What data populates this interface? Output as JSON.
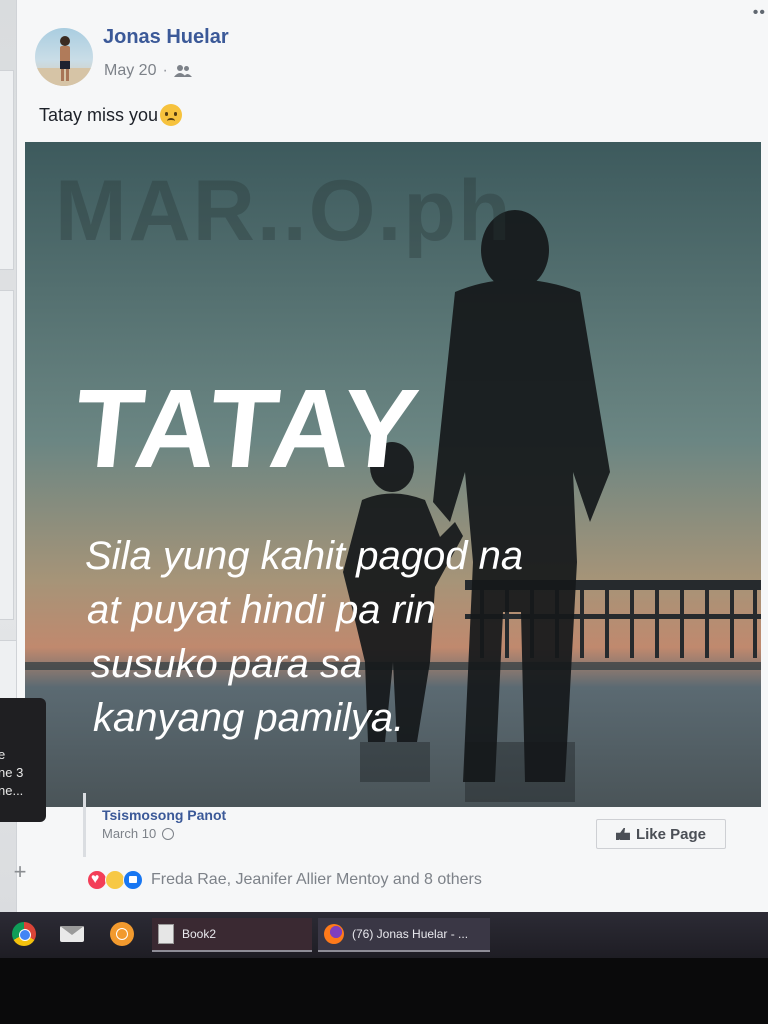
{
  "post": {
    "author": "Jonas Huelar",
    "date": "May 20",
    "audience_icon": "friends-icon",
    "text": "Tatay miss you",
    "text_emoji": "sad-face-emoji",
    "image": {
      "watermark": "MAR..O.ph",
      "title": "TATAY",
      "quote_lines": [
        "Sila yung kahit pagod na",
        "at puyat hindi pa rin",
        "susuko para sa",
        "kanyang pamilya."
      ]
    },
    "attribution": {
      "page_name": "Tsismosong Panot",
      "date": "March 10",
      "privacy_icon": "globe-icon",
      "like_page_label": "Like Page"
    },
    "reactions": {
      "icons": [
        "love-reaction",
        "sad-reaction",
        "like-reaction"
      ],
      "text": "Freda Rae, Jeanifer Allier Mentoy and 8 others"
    }
  },
  "sidebar": {
    "tooltip_lines": [
      "e",
      "ne 3",
      "ne..."
    ],
    "plus_label": "+"
  },
  "top_right_menu": "••",
  "taskbar": {
    "tasks": [
      {
        "label": "Book2",
        "icon": "document-icon"
      },
      {
        "label": "(76) Jonas Huelar - ...",
        "icon": "firefox-icon"
      }
    ],
    "pinned_icons": [
      "chrome-icon",
      "mail-icon",
      "app-circle-icon"
    ]
  },
  "colors": {
    "link_blue": "#3b5998",
    "meta_gray": "#7d8289",
    "taskbar": "#2c2b35"
  }
}
